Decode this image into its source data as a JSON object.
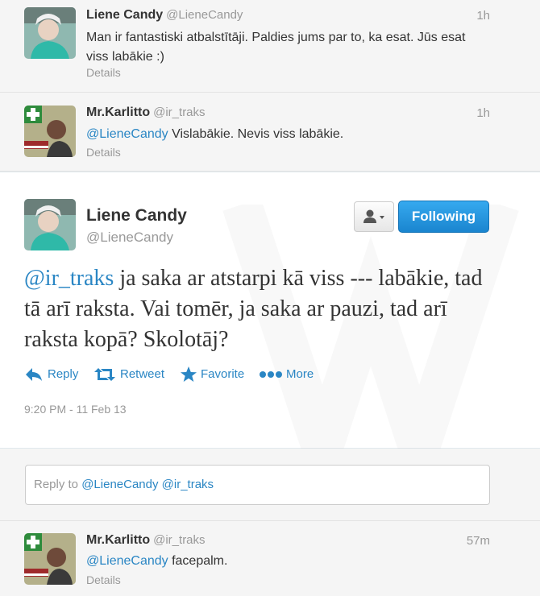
{
  "tweets_above": [
    {
      "name": "Liene Candy",
      "handle": "@LieneCandy",
      "time": "1h",
      "text": "Man ir fantastiski atbalstītāji. Paldies jums par to, ka esat. Jūs esat viss labākie :)",
      "details": "Details"
    },
    {
      "name": "Mr.Karlitto",
      "handle": "@ir_traks",
      "time": "1h",
      "mention": "@LieneCandy",
      "text": " Vislabākie. Nevis viss labākie.",
      "details": "Details"
    }
  ],
  "main_tweet": {
    "name": "Liene Candy",
    "handle": "@LieneCandy",
    "follow_label": "Following",
    "mention": "@ir_traks",
    "text": " ja saka ar atstarpi kā viss --- labākie, tad tā arī raksta. Vai tomēr, ja saka ar pauzi, tad arī raksta kopā? Skolotāj?",
    "actions": {
      "reply": "Reply",
      "retweet": "Retweet",
      "favorite": "Favorite",
      "more": "More"
    },
    "timestamp": "9:20 PM - 11 Feb 13"
  },
  "reply_box": {
    "prefix": "Reply to ",
    "mentions": "@LieneCandy @ir_traks"
  },
  "tweets_below": [
    {
      "name": "Mr.Karlitto",
      "handle": "@ir_traks",
      "time": "57m",
      "mention": "@LieneCandy",
      "text": " facepalm.",
      "details": "Details"
    }
  ],
  "colors": {
    "link": "#2a86c4",
    "following_button": "#1a85cf",
    "muted": "#999999"
  }
}
